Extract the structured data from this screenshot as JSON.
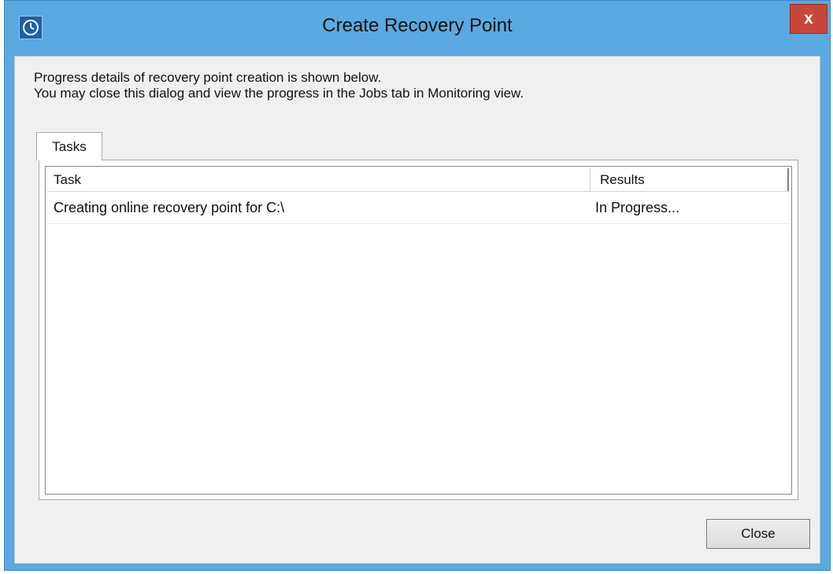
{
  "window": {
    "title": "Create Recovery Point",
    "close_glyph": "x",
    "app_icon": "clock-icon",
    "frame_color": "#5aa9e0",
    "close_color": "#c7473a"
  },
  "description": {
    "line1": "Progress details of recovery point creation is shown below.",
    "line2": "You may close this dialog and view the progress in the Jobs tab in Monitoring view."
  },
  "tabs": [
    {
      "label": "Tasks",
      "selected": true
    }
  ],
  "table": {
    "columns": [
      "Task",
      "Results"
    ],
    "rows": [
      {
        "task": "Creating online recovery point for C:\\",
        "result": "In Progress..."
      }
    ]
  },
  "buttons": {
    "close_label": "Close"
  }
}
